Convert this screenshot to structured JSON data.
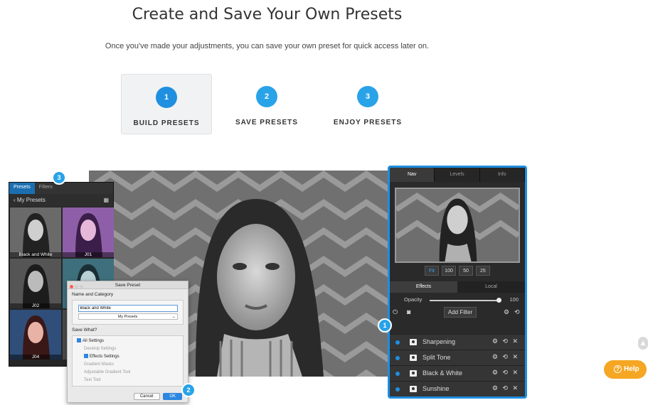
{
  "header": {
    "title": "Create and Save Your Own Presets",
    "subtitle": "Once you've made your adjustments, you can save your own preset for quick access later on."
  },
  "steps": [
    {
      "num": "1",
      "label": "BUILD PRESETS"
    },
    {
      "num": "2",
      "label": "SAVE PRESETS"
    },
    {
      "num": "3",
      "label": "ENJOY PRESETS"
    }
  ],
  "presets_panel": {
    "tab_presets": "Presets",
    "tab_filters": "Filters",
    "header": "My Presets",
    "thumbs": [
      "Black and White",
      "J01",
      "J02",
      "",
      "J04",
      ""
    ]
  },
  "save_dialog": {
    "title": "Save Preset",
    "section_name": "Name and Category",
    "name_value": "Black and White",
    "category_value": "My Presets",
    "section_what": "Save What?",
    "options": [
      "All Settings",
      "Develop Settings",
      "Effects Settings",
      "Gradient Masks",
      "Adjustable Gradient Tool",
      "Text Tool"
    ],
    "cancel": "Cancel",
    "ok": "OK"
  },
  "right_panel": {
    "tabs": [
      "Nav",
      "Levels",
      "Info"
    ],
    "zoom": [
      "Fit",
      "100",
      "50",
      "25"
    ],
    "subtabs": [
      "Effects",
      "Local"
    ],
    "opacity_label": "Opacity",
    "opacity_value": "100",
    "opacity_fraction": 0.97,
    "add_filter": "Add Filter",
    "filters": [
      "Sharpening",
      "Split Tone",
      "Black & White",
      "Sunshine"
    ],
    "filter_actions": "⚙ ⟲ ✕"
  },
  "badges": {
    "one": "1",
    "two": "2",
    "three": "3"
  },
  "help": {
    "label": "Help"
  },
  "colors": {
    "accent": "#1f8fe0",
    "step_circle": "#29a3e8",
    "help": "#f5a623"
  }
}
